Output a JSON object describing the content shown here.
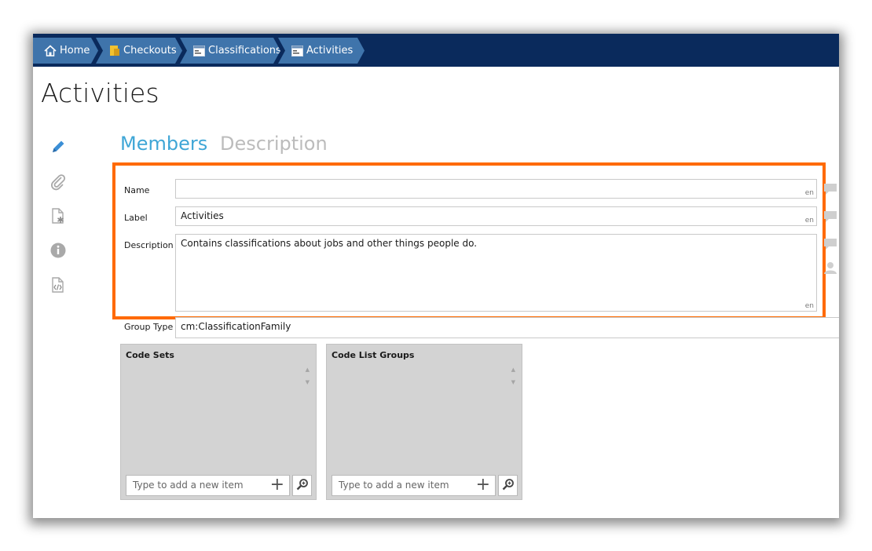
{
  "breadcrumb": {
    "items": [
      {
        "label": "Home",
        "icon": "home-icon"
      },
      {
        "label": "Checkouts",
        "icon": "checkouts-icon"
      },
      {
        "label": "Classifications",
        "icon": "classification-icon"
      },
      {
        "label": "Activities",
        "icon": "classification-icon"
      }
    ]
  },
  "page": {
    "title": "Activities"
  },
  "sidebar": {
    "icons": [
      "pencil-icon",
      "paperclip-icon",
      "document-asterisk-icon",
      "info-icon",
      "code-document-icon"
    ]
  },
  "tabs": {
    "members": "Members",
    "description": "Description"
  },
  "form": {
    "name": {
      "label": "Name",
      "value": "",
      "lang": "en"
    },
    "label": {
      "label": "Label",
      "value": "Activities",
      "lang": "en"
    },
    "description": {
      "label": "Description",
      "value": "Contains classifications about jobs and other things people do.",
      "lang": "en"
    },
    "group_type": {
      "label": "Group Type",
      "value": "cm:ClassificationFamily"
    }
  },
  "panels": [
    {
      "title": "Code Sets",
      "placeholder": "Type to add a new item"
    },
    {
      "title": "Code List Groups",
      "placeholder": "Type to add a new item"
    }
  ],
  "colors": {
    "header": "#0a2a5c",
    "crumb": "#3f74ab",
    "accent": "#3fa6d6",
    "highlight": "#ff6a00"
  }
}
